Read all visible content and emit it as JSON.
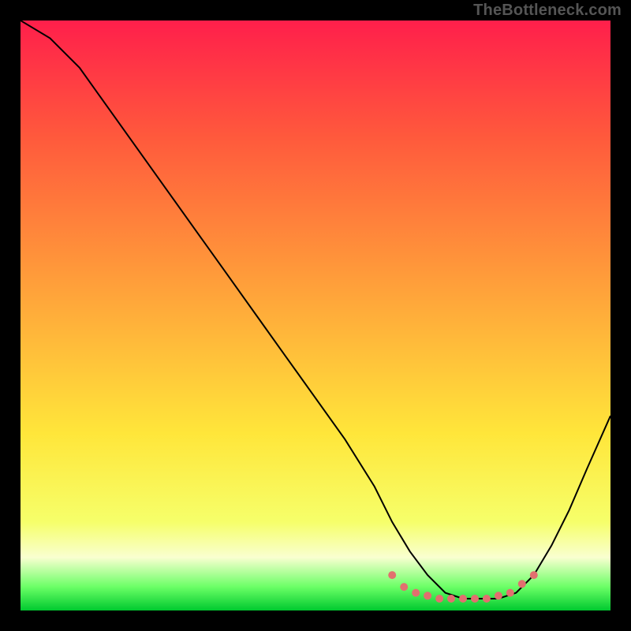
{
  "watermark": "TheBottleneck.com",
  "chart_data": {
    "type": "line",
    "title": "",
    "xlabel": "",
    "ylabel": "",
    "xlim": [
      0,
      100
    ],
    "ylim": [
      0,
      100
    ],
    "gradient_stops": [
      {
        "offset": 0,
        "color": "#ff1f4b"
      },
      {
        "offset": 20,
        "color": "#ff5a3c"
      },
      {
        "offset": 45,
        "color": "#ffa03a"
      },
      {
        "offset": 70,
        "color": "#ffe63a"
      },
      {
        "offset": 85,
        "color": "#f6ff6a"
      },
      {
        "offset": 91,
        "color": "#f9ffd0"
      },
      {
        "offset": 96,
        "color": "#6bff66"
      },
      {
        "offset": 100,
        "color": "#00c92f"
      }
    ],
    "series": [
      {
        "name": "bottleneck-curve",
        "color": "#000000",
        "x": [
          0,
          5,
          10,
          15,
          20,
          25,
          30,
          35,
          40,
          45,
          50,
          55,
          60,
          63,
          66,
          69,
          72,
          75,
          78,
          81,
          84,
          87,
          90,
          93,
          96,
          100
        ],
        "y": [
          100,
          97,
          92,
          85,
          78,
          71,
          64,
          57,
          50,
          43,
          36,
          29,
          21,
          15,
          10,
          6,
          3,
          2,
          2,
          2,
          3,
          6,
          11,
          17,
          24,
          33
        ]
      }
    ],
    "highlight": {
      "name": "optimal-zone",
      "color": "#e26f6f",
      "x": [
        63,
        65,
        67,
        69,
        71,
        73,
        75,
        77,
        79,
        81,
        83,
        85,
        87
      ],
      "y": [
        6,
        4,
        3,
        2.5,
        2,
        2,
        2,
        2,
        2,
        2.5,
        3,
        4.5,
        6
      ]
    }
  }
}
